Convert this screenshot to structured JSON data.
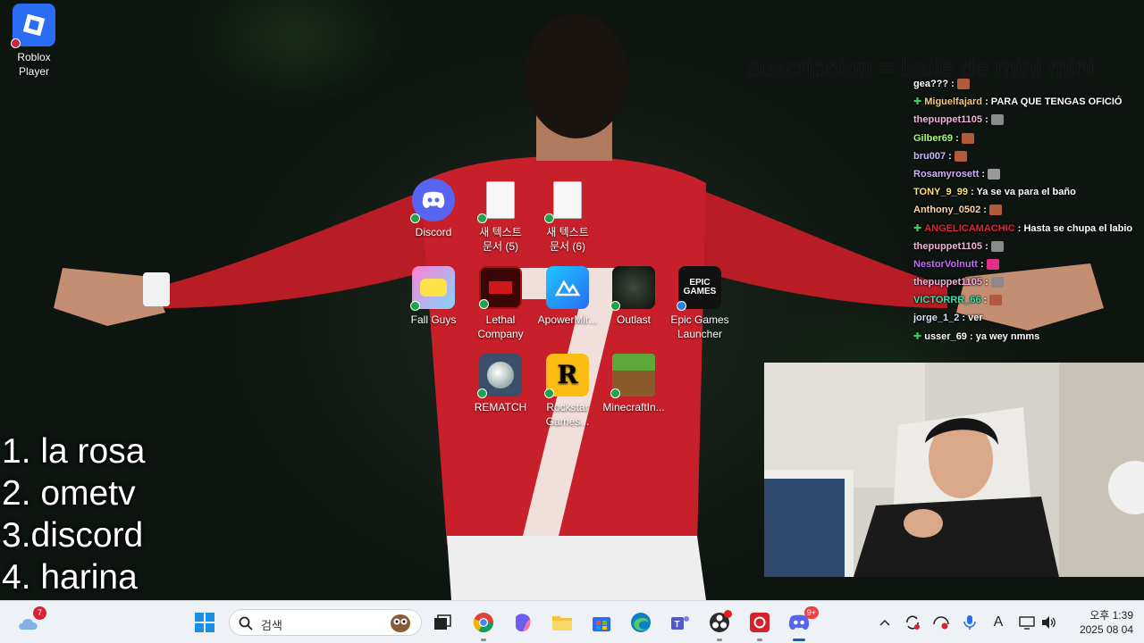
{
  "desktop": {
    "icons": [
      {
        "label": "Roblox\nPlayer",
        "icon": "roblox-icon",
        "color": "#2a6df4"
      },
      {
        "label": "Discord",
        "icon": "discord-icon",
        "color": "#5865f2"
      },
      {
        "label": "새 텍스트\n문서 (5)",
        "icon": "text-document-icon"
      },
      {
        "label": "새 텍스트\n문서 (6)",
        "icon": "text-document-icon"
      },
      {
        "label": "Fall Guys",
        "icon": "fall-guys-icon"
      },
      {
        "label": "Lethal\nCompany",
        "icon": "lethal-company-icon"
      },
      {
        "label": "ApowerMir...",
        "icon": "apowermirror-icon"
      },
      {
        "label": "Outlast",
        "icon": "outlast-icon"
      },
      {
        "label": "Epic Games\nLauncher",
        "icon": "epic-games-icon",
        "logo_text": "EPIC\nGAMES"
      },
      {
        "label": "REMATCH",
        "icon": "rematch-icon"
      },
      {
        "label": "Rockstar\nGames...",
        "icon": "rockstar-icon",
        "logo_text": "R"
      },
      {
        "label": "MinecraftIn...",
        "icon": "minecraft-icon"
      }
    ]
  },
  "overlay": {
    "banner": "suscripcion = baile de mini mini",
    "rules": [
      "1. la rosa",
      "2. ometv",
      "3.discord",
      "4. harina"
    ]
  },
  "chat": {
    "messages": [
      {
        "user": "gea???",
        "text": "",
        "color": "#ffffff",
        "badge": false,
        "emote": "#b25a3c"
      },
      {
        "user": "Miguelfajard",
        "text": "PARA QUE TENGAS OFICIÓ",
        "color": "#f5c77e",
        "badge": true
      },
      {
        "user": "thepuppet1105",
        "text": "",
        "color": "#f0b4d8",
        "badge": false,
        "emote": "#8a8a8a"
      },
      {
        "user": "Gilber69",
        "text": "",
        "color": "#a8ff6a",
        "badge": false,
        "emote": "#b25a3c"
      },
      {
        "user": "bru007",
        "text": "",
        "color": "#c9b8ff",
        "badge": false,
        "emote": "#b25a3c"
      },
      {
        "user": "Rosamyrosett",
        "text": "",
        "color": "#d6b0ff",
        "badge": false,
        "emote": "#9a9a9a"
      },
      {
        "user": "TONY_9_99",
        "text": "Ya se va para el baño",
        "color": "#ffe36b",
        "badge": false
      },
      {
        "user": "Anthony_0502",
        "text": "",
        "color": "#ffd7a8",
        "badge": false,
        "emote": "#b25a3c"
      },
      {
        "user": "ANGELICAMACHIC",
        "text": "Hasta se chupa el labio",
        "color": "#e0263c",
        "badge": true
      },
      {
        "user": "thepuppet1105",
        "text": "",
        "color": "#f0b4d8",
        "badge": false,
        "emote": "#8a8a8a"
      },
      {
        "user": "NestorVolnutt",
        "text": "",
        "color": "#c46bff",
        "badge": false,
        "emote": "#e0308a"
      },
      {
        "user": "thepuppet1105",
        "text": "",
        "color": "#f0b4d8",
        "badge": false,
        "emote": "#8a8a8a"
      },
      {
        "user": "VICTORRR_66",
        "text": "",
        "color": "#3ae0a6",
        "badge": false,
        "emote": "#b25a3c"
      },
      {
        "user": "jorge_1_2",
        "text": "ver",
        "color": "#d9e4ff",
        "badge": false
      },
      {
        "user": "usser_69",
        "text": "ya wey nmms",
        "color": "#ffffff",
        "badge": true
      }
    ]
  },
  "taskbar": {
    "weather_badge": "7",
    "search_placeholder": "검색",
    "discord_badge": "9+",
    "clock_time": "오후 1:39",
    "clock_date": "2025 08 04"
  },
  "colors": {
    "jersey_red": "#c8202a",
    "taskbar_bg": "#eef1f6",
    "accent_blue": "#0067c0"
  }
}
